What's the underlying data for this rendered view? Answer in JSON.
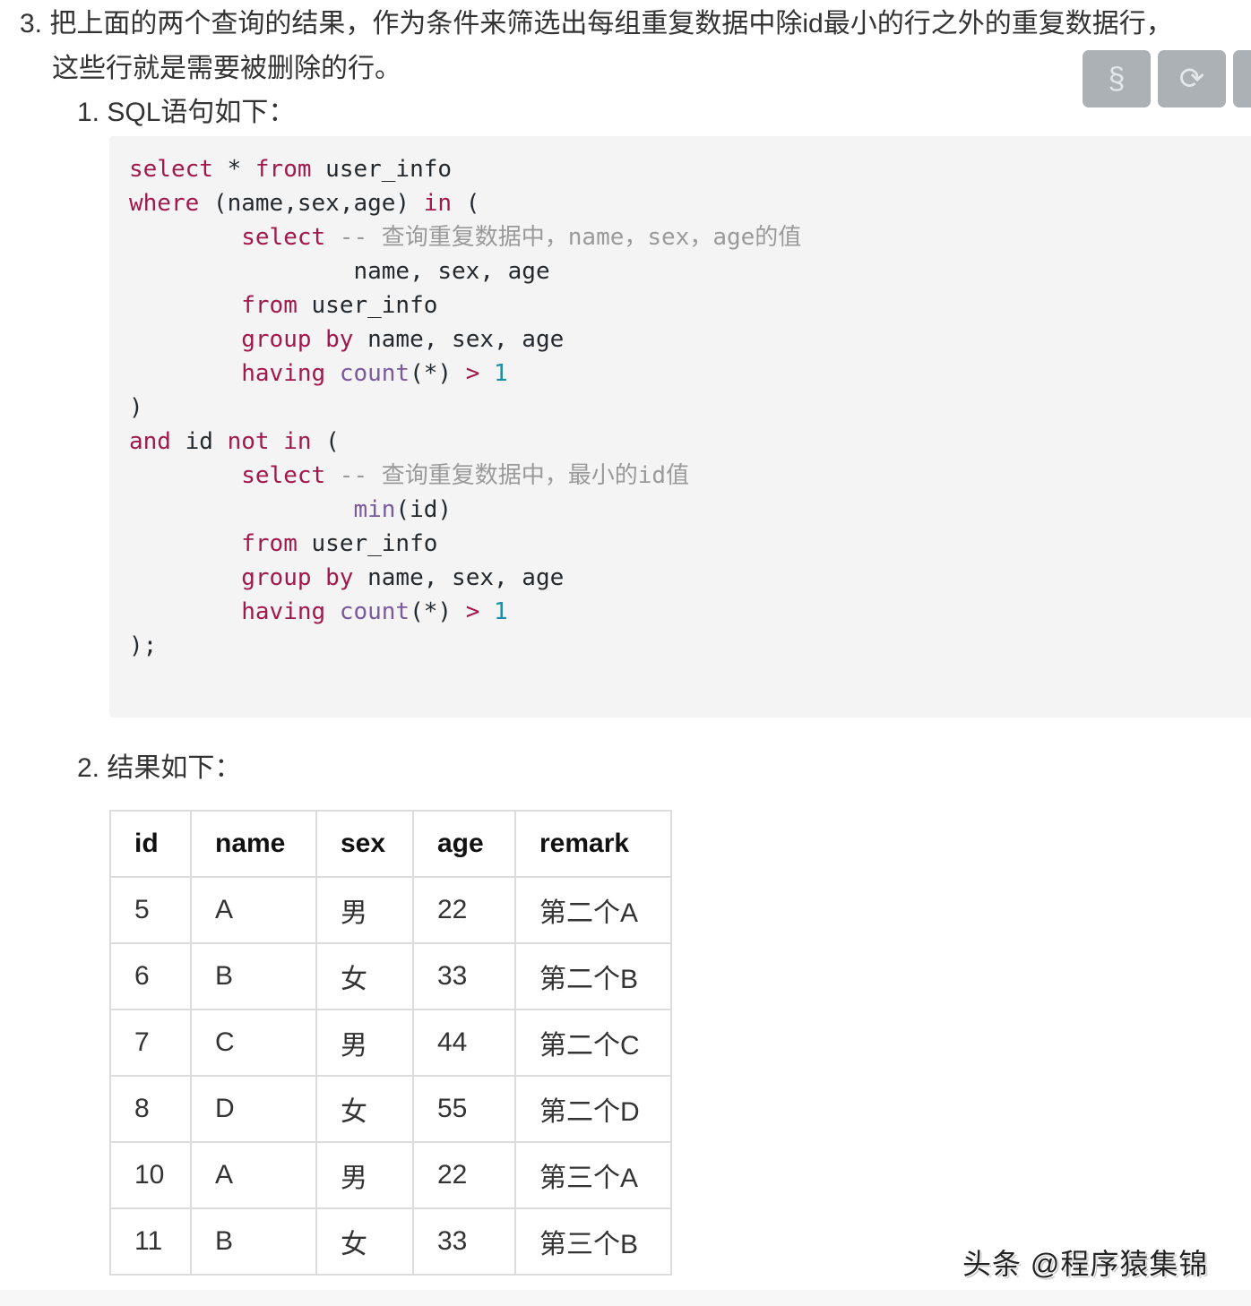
{
  "step3": {
    "number": "3.",
    "line1": "把上面的两个查询的结果，作为条件来筛选出每组重复数据中除id最小的行之外的重复数据行，",
    "line2": "这些行就是需要被删除的行。"
  },
  "toolbar": {
    "section_icon": "§",
    "refresh_icon": "⟳"
  },
  "sub1": {
    "number": "1.",
    "label": "SQL语句如下："
  },
  "code": {
    "l1": {
      "k1": "select",
      "op": " * ",
      "k2": "from",
      "t": " user_info"
    },
    "l2": {
      "k1": "where",
      "t": " (name,sex,age) ",
      "k2": "in",
      "t2": " ("
    },
    "l3": {
      "indent": "        ",
      "k1": "select",
      "c": " -- 查询重复数据中，name，sex，age的值"
    },
    "l4": {
      "t": "                name, sex, age"
    },
    "l5": {
      "indent": "        ",
      "k1": "from",
      "t": " user_info"
    },
    "l6": {
      "indent": "        ",
      "k1": "group by",
      "t": " name, sex, age"
    },
    "l7": {
      "indent": "        ",
      "k1": "having",
      "sp": " ",
      "fn": "count",
      "t": "(*) ",
      "op": ">",
      "sp2": " ",
      "n": "1"
    },
    "l8": {
      "t": ")"
    },
    "l9": {
      "k1": "and",
      "t": " id ",
      "k2": "not in",
      "t2": " ("
    },
    "l10": {
      "indent": "        ",
      "k1": "select",
      "c": " -- 查询重复数据中，最小的id值"
    },
    "l11": {
      "indent": "                ",
      "fn": "min",
      "t": "(id)"
    },
    "l12": {
      "indent": "        ",
      "k1": "from",
      "t": " user_info"
    },
    "l13": {
      "indent": "        ",
      "k1": "group by",
      "t": " name, sex, age"
    },
    "l14": {
      "indent": "        ",
      "k1": "having",
      "sp": " ",
      "fn": "count",
      "t": "(*) ",
      "op": ">",
      "sp2": " ",
      "n": "1"
    },
    "l15": {
      "t": ");"
    }
  },
  "sub2": {
    "number": "2.",
    "label": "结果如下："
  },
  "table": {
    "headers": [
      "id",
      "name",
      "sex",
      "age",
      "remark"
    ],
    "rows": [
      [
        "5",
        "A",
        "男",
        "22",
        "第二个A"
      ],
      [
        "6",
        "B",
        "女",
        "33",
        "第二个B"
      ],
      [
        "7",
        "C",
        "男",
        "44",
        "第二个C"
      ],
      [
        "8",
        "D",
        "女",
        "55",
        "第二个D"
      ],
      [
        "10",
        "A",
        "男",
        "22",
        "第三个A"
      ],
      [
        "11",
        "B",
        "女",
        "33",
        "第三个B"
      ]
    ]
  },
  "watermark": "头条 @程序猿集锦",
  "colors": {
    "keyword": "#a1184c",
    "function": "#7a5a9c",
    "number": "#1d8ea6",
    "comment": "#9a9a9a",
    "code_bg": "#f4f4f4",
    "button_bg": "#abb1b5"
  }
}
